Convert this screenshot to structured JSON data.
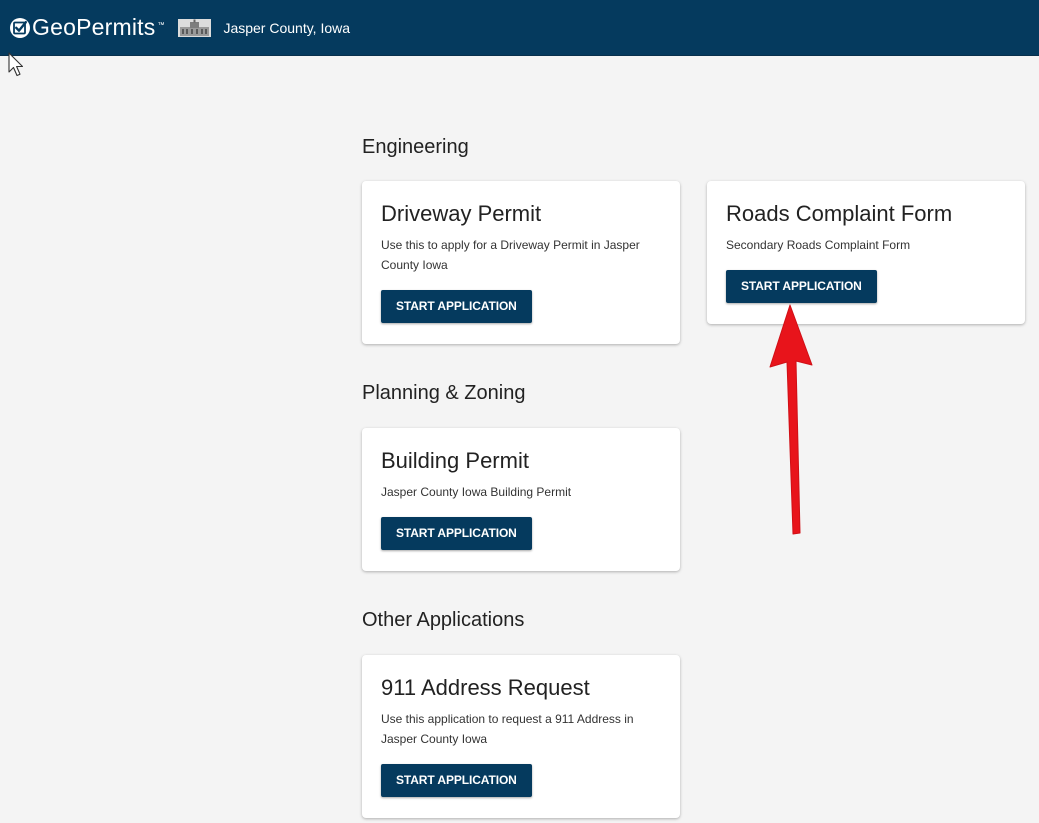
{
  "header": {
    "app_name": "GeoPermits",
    "trademark": "™",
    "county_name": "Jasper County, Iowa",
    "background_color": "#053a5e"
  },
  "sections": [
    {
      "title": "Engineering",
      "cards": [
        {
          "title": "Driveway Permit",
          "description": "Use this to apply for a Driveway Permit in Jasper County Iowa",
          "button_label": "START APPLICATION"
        },
        {
          "title": "Roads Complaint Form",
          "description": "Secondary Roads Complaint Form",
          "button_label": "START APPLICATION"
        }
      ]
    },
    {
      "title": "Planning & Zoning",
      "cards": [
        {
          "title": "Building Permit",
          "description": "Jasper County Iowa Building Permit",
          "button_label": "START APPLICATION"
        }
      ]
    },
    {
      "title": "Other Applications",
      "cards": [
        {
          "title": "911 Address Request",
          "description": "Use this application to request a 911 Address in Jasper County Iowa",
          "button_label": "START APPLICATION"
        }
      ]
    }
  ],
  "icons": [
    "geopermits-logo-icon",
    "county-seal-icon",
    "mouse-cursor-icon",
    "red-arrow-annotation"
  ],
  "colors": {
    "accent": "#053a5e",
    "page_background": "#f4f4f4",
    "annotation_arrow": "#e8141b"
  }
}
